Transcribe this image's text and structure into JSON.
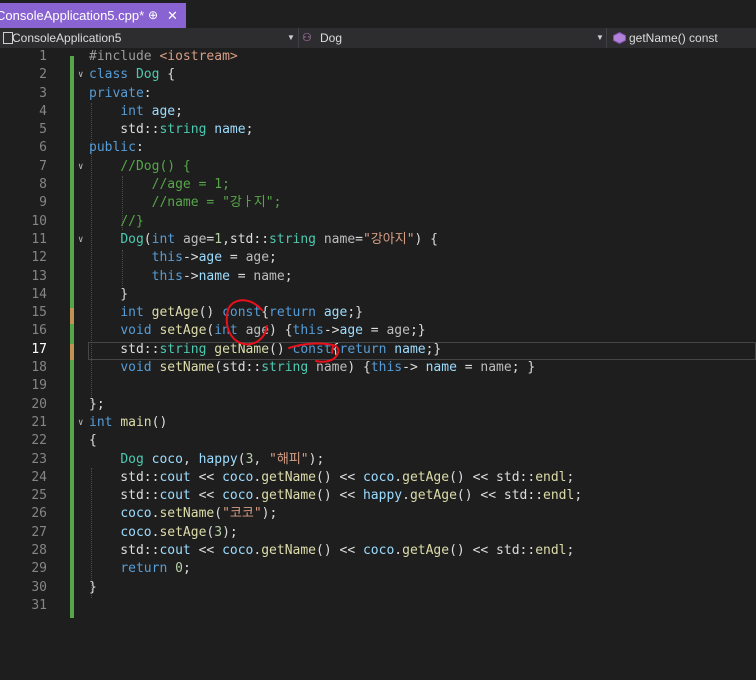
{
  "tab": {
    "title": "ConsoleApplication5.cpp*",
    "pin": "⊕",
    "close": "✕"
  },
  "navbar": {
    "project": "ConsoleApplication5",
    "scope": "Dog",
    "member": "getName() const"
  },
  "current_line": 17,
  "lines": [
    {
      "n": "1",
      "t": [
        [
          "pp",
          "#include <iostream>"
        ]
      ]
    },
    {
      "n": "2",
      "t": [
        [
          "kw",
          "class"
        ],
        [
          "p",
          " "
        ],
        [
          "ty",
          "Dog"
        ],
        [
          "p",
          " {"
        ]
      ]
    },
    {
      "n": "3",
      "t": [
        [
          "kw",
          "private"
        ],
        [
          "p",
          ":"
        ]
      ]
    },
    {
      "n": "4",
      "t": [
        [
          "p",
          "    "
        ],
        [
          "kw",
          "int"
        ],
        [
          "p",
          " "
        ],
        [
          "var",
          "age"
        ],
        [
          "p",
          ";"
        ]
      ]
    },
    {
      "n": "5",
      "t": [
        [
          "p",
          "    std::"
        ],
        [
          "ty",
          "string"
        ],
        [
          "p",
          " "
        ],
        [
          "var",
          "name"
        ],
        [
          "p",
          ";"
        ]
      ]
    },
    {
      "n": "6",
      "t": [
        [
          "kw",
          "public"
        ],
        [
          "p",
          ":"
        ]
      ]
    },
    {
      "n": "7",
      "t": [
        [
          "p",
          "    "
        ],
        [
          "cm",
          "//Dog() {"
        ]
      ]
    },
    {
      "n": "8",
      "t": [
        [
          "p",
          "        "
        ],
        [
          "cm",
          "//age = 1;"
        ]
      ]
    },
    {
      "n": "9",
      "t": [
        [
          "p",
          "        "
        ],
        [
          "cm",
          "//name = \"강ㅏ지\";"
        ]
      ]
    },
    {
      "n": "10",
      "t": [
        [
          "p",
          "    "
        ],
        [
          "cm",
          "//}"
        ]
      ]
    },
    {
      "n": "11",
      "t": [
        [
          "p",
          "    "
        ],
        [
          "ty",
          "Dog"
        ],
        [
          "p",
          "("
        ],
        [
          "kw",
          "int"
        ],
        [
          "p",
          " "
        ],
        [
          "gv",
          "age"
        ],
        [
          "p",
          "="
        ],
        [
          "num",
          "1"
        ],
        [
          "p",
          ",std::"
        ],
        [
          "ty",
          "string"
        ],
        [
          "p",
          " "
        ],
        [
          "gv",
          "name"
        ],
        [
          "p",
          "="
        ],
        [
          "str",
          "\"강아지\""
        ],
        [
          "p",
          ") {"
        ]
      ]
    },
    {
      "n": "12",
      "t": [
        [
          "p",
          "        "
        ],
        [
          "kw",
          "this"
        ],
        [
          "p",
          "->"
        ],
        [
          "var",
          "age"
        ],
        [
          "p",
          " = "
        ],
        [
          "gv",
          "age"
        ],
        [
          "p",
          ";"
        ]
      ]
    },
    {
      "n": "13",
      "t": [
        [
          "p",
          "        "
        ],
        [
          "kw",
          "this"
        ],
        [
          "p",
          "->"
        ],
        [
          "var",
          "name"
        ],
        [
          "p",
          " = "
        ],
        [
          "gv",
          "name"
        ],
        [
          "p",
          ";"
        ]
      ]
    },
    {
      "n": "14",
      "t": [
        [
          "p",
          "    }"
        ]
      ]
    },
    {
      "n": "15",
      "t": [
        [
          "p",
          "    "
        ],
        [
          "kw",
          "int"
        ],
        [
          "p",
          " "
        ],
        [
          "fn",
          "getAge"
        ],
        [
          "p",
          "() "
        ],
        [
          "kw",
          "const"
        ],
        [
          "p",
          "{"
        ],
        [
          "kw",
          "return"
        ],
        [
          "p",
          " "
        ],
        [
          "var",
          "age"
        ],
        [
          "p",
          ";}"
        ]
      ]
    },
    {
      "n": "16",
      "t": [
        [
          "p",
          "    "
        ],
        [
          "kw",
          "void"
        ],
        [
          "p",
          " "
        ],
        [
          "fn",
          "setAge"
        ],
        [
          "p",
          "("
        ],
        [
          "kw",
          "int"
        ],
        [
          "p",
          " "
        ],
        [
          "gv",
          "age"
        ],
        [
          "p",
          ") {"
        ],
        [
          "kw",
          "this"
        ],
        [
          "p",
          "->"
        ],
        [
          "var",
          "age"
        ],
        [
          "p",
          " = "
        ],
        [
          "gv",
          "age"
        ],
        [
          "p",
          ";}"
        ]
      ]
    },
    {
      "n": "17",
      "t": [
        [
          "p",
          "    std::"
        ],
        [
          "ty",
          "string"
        ],
        [
          "p",
          " "
        ],
        [
          "fn",
          "getName"
        ],
        [
          "p",
          "() "
        ],
        [
          "kw",
          "const"
        ],
        [
          "p",
          "{"
        ],
        [
          "kw",
          "return"
        ],
        [
          "p",
          " "
        ],
        [
          "var",
          "name"
        ],
        [
          "p",
          ";}"
        ]
      ]
    },
    {
      "n": "18",
      "t": [
        [
          "p",
          "    "
        ],
        [
          "kw",
          "void"
        ],
        [
          "p",
          " "
        ],
        [
          "fn",
          "setName"
        ],
        [
          "p",
          "(std::"
        ],
        [
          "ty",
          "string"
        ],
        [
          "p",
          " "
        ],
        [
          "gv",
          "name"
        ],
        [
          "p",
          ") {"
        ],
        [
          "kw",
          "this"
        ],
        [
          "p",
          "-> "
        ],
        [
          "var",
          "name"
        ],
        [
          "p",
          " = "
        ],
        [
          "gv",
          "name"
        ],
        [
          "p",
          "; }"
        ]
      ]
    },
    {
      "n": "19",
      "t": []
    },
    {
      "n": "20",
      "t": [
        [
          "p",
          "};"
        ]
      ]
    },
    {
      "n": "21",
      "t": [
        [
          "kw",
          "int"
        ],
        [
          "p",
          " "
        ],
        [
          "fn",
          "main"
        ],
        [
          "p",
          "()"
        ]
      ]
    },
    {
      "n": "22",
      "t": [
        [
          "p",
          "{"
        ]
      ]
    },
    {
      "n": "23",
      "t": [
        [
          "p",
          "    "
        ],
        [
          "ty",
          "Dog"
        ],
        [
          "p",
          " "
        ],
        [
          "var",
          "coco"
        ],
        [
          "p",
          ", "
        ],
        [
          "var",
          "happy"
        ],
        [
          "p",
          "("
        ],
        [
          "num",
          "3"
        ],
        [
          "p",
          ", "
        ],
        [
          "str",
          "\"해피\""
        ],
        [
          "p",
          ");"
        ]
      ]
    },
    {
      "n": "24",
      "t": [
        [
          "p",
          "    std::"
        ],
        [
          "var",
          "cout"
        ],
        [
          "p",
          " << "
        ],
        [
          "var",
          "coco"
        ],
        [
          "p",
          "."
        ],
        [
          "fn",
          "getName"
        ],
        [
          "p",
          "() << "
        ],
        [
          "var",
          "coco"
        ],
        [
          "p",
          "."
        ],
        [
          "fn",
          "getAge"
        ],
        [
          "p",
          "() << std::"
        ],
        [
          "fn",
          "endl"
        ],
        [
          "p",
          ";"
        ]
      ]
    },
    {
      "n": "25",
      "t": [
        [
          "p",
          "    std::"
        ],
        [
          "var",
          "cout"
        ],
        [
          "p",
          " << "
        ],
        [
          "var",
          "coco"
        ],
        [
          "p",
          "."
        ],
        [
          "fn",
          "getName"
        ],
        [
          "p",
          "() << "
        ],
        [
          "var",
          "happy"
        ],
        [
          "p",
          "."
        ],
        [
          "fn",
          "getAge"
        ],
        [
          "p",
          "() << std::"
        ],
        [
          "fn",
          "endl"
        ],
        [
          "p",
          ";"
        ]
      ]
    },
    {
      "n": "26",
      "t": [
        [
          "p",
          "    "
        ],
        [
          "var",
          "coco"
        ],
        [
          "p",
          "."
        ],
        [
          "fn",
          "setName"
        ],
        [
          "p",
          "("
        ],
        [
          "str",
          "\"코코\""
        ],
        [
          "p",
          ");"
        ]
      ]
    },
    {
      "n": "27",
      "t": [
        [
          "p",
          "    "
        ],
        [
          "var",
          "coco"
        ],
        [
          "p",
          "."
        ],
        [
          "fn",
          "setAge"
        ],
        [
          "p",
          "("
        ],
        [
          "num",
          "3"
        ],
        [
          "p",
          ");"
        ]
      ]
    },
    {
      "n": "28",
      "t": [
        [
          "p",
          "    std::"
        ],
        [
          "var",
          "cout"
        ],
        [
          "p",
          " << "
        ],
        [
          "var",
          "coco"
        ],
        [
          "p",
          "."
        ],
        [
          "fn",
          "getName"
        ],
        [
          "p",
          "() << "
        ],
        [
          "var",
          "coco"
        ],
        [
          "p",
          "."
        ],
        [
          "fn",
          "getAge"
        ],
        [
          "p",
          "() << std::"
        ],
        [
          "fn",
          "endl"
        ],
        [
          "p",
          ";"
        ]
      ]
    },
    {
      "n": "29",
      "t": [
        [
          "p",
          "    "
        ],
        [
          "kw",
          "return"
        ],
        [
          "p",
          " "
        ],
        [
          "num",
          "0"
        ],
        [
          "p",
          ";"
        ]
      ]
    },
    {
      "n": "30",
      "t": [
        [
          "p",
          "}"
        ]
      ]
    },
    {
      "n": "31",
      "t": []
    }
  ],
  "folds": [
    "2",
    "7",
    "11",
    "21"
  ],
  "modified_lines": [
    "15",
    "17"
  ],
  "colors": {
    "accent": "#8a63d2",
    "saved_change": "#57a64a",
    "unsaved_change": "#c09553",
    "annotation_ink": "#e8101a"
  }
}
